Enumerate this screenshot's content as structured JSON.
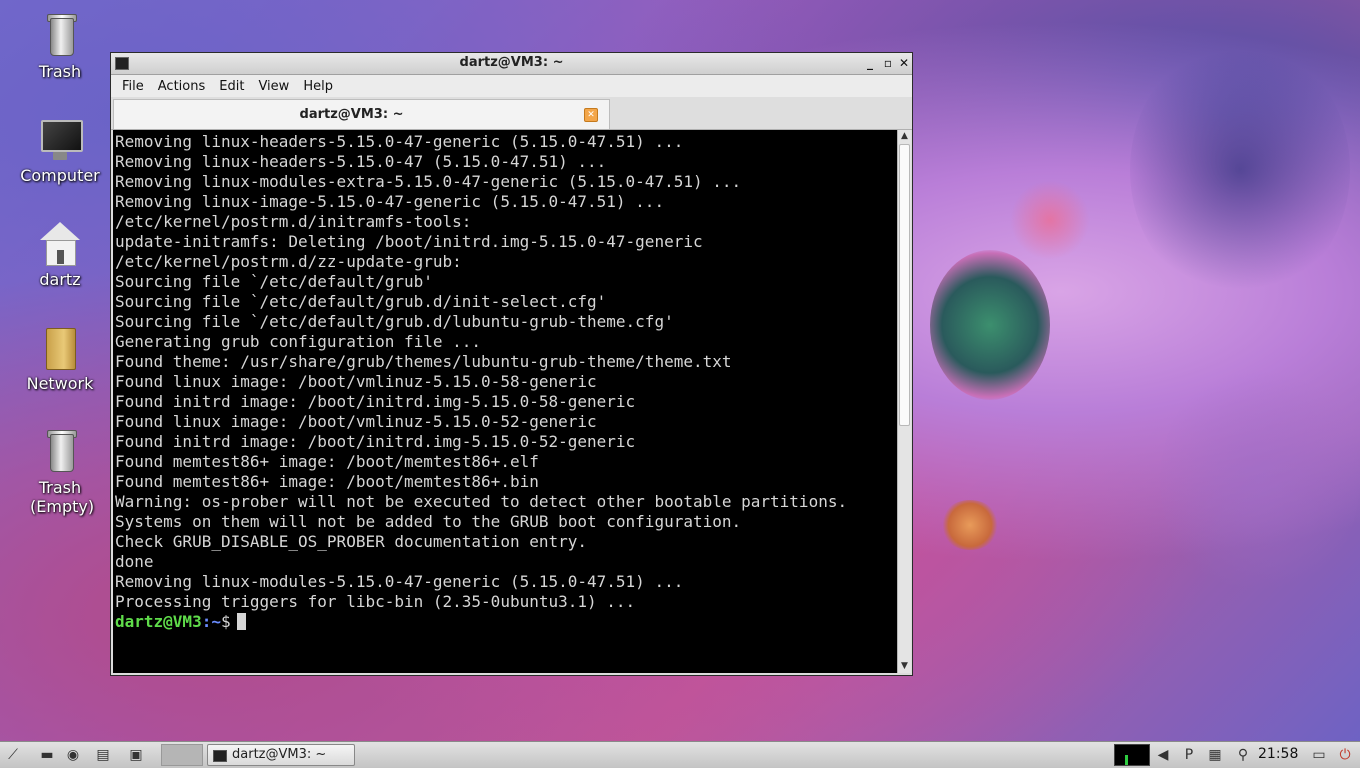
{
  "desktop": {
    "icons": [
      {
        "label": "Trash"
      },
      {
        "label": "Computer"
      },
      {
        "label": "dartz"
      },
      {
        "label": "Network"
      },
      {
        "label": "Trash (Empty)"
      }
    ]
  },
  "window": {
    "title": "dartz@VM3: ~",
    "menu": [
      "File",
      "Actions",
      "Edit",
      "View",
      "Help"
    ],
    "tab_label": "dartz@VM3: ~"
  },
  "terminal": {
    "lines": [
      "Removing linux-headers-5.15.0-47-generic (5.15.0-47.51) ...",
      "Removing linux-headers-5.15.0-47 (5.15.0-47.51) ...",
      "Removing linux-modules-extra-5.15.0-47-generic (5.15.0-47.51) ...",
      "Removing linux-image-5.15.0-47-generic (5.15.0-47.51) ...",
      "/etc/kernel/postrm.d/initramfs-tools:",
      "update-initramfs: Deleting /boot/initrd.img-5.15.0-47-generic",
      "/etc/kernel/postrm.d/zz-update-grub:",
      "Sourcing file `/etc/default/grub'",
      "Sourcing file `/etc/default/grub.d/init-select.cfg'",
      "Sourcing file `/etc/default/grub.d/lubuntu-grub-theme.cfg'",
      "Generating grub configuration file ...",
      "Found theme: /usr/share/grub/themes/lubuntu-grub-theme/theme.txt",
      "Found linux image: /boot/vmlinuz-5.15.0-58-generic",
      "Found initrd image: /boot/initrd.img-5.15.0-58-generic",
      "Found linux image: /boot/vmlinuz-5.15.0-52-generic",
      "Found initrd image: /boot/initrd.img-5.15.0-52-generic",
      "Found memtest86+ image: /boot/memtest86+.elf",
      "Found memtest86+ image: /boot/memtest86+.bin",
      "Warning: os-prober will not be executed to detect other bootable partitions.",
      "Systems on them will not be added to the GRUB boot configuration.",
      "Check GRUB_DISABLE_OS_PROBER documentation entry.",
      "done",
      "Removing linux-modules-5.15.0-47-generic (5.15.0-47.51) ...",
      "Processing triggers for libc-bin (2.35-0ubuntu3.1) ..."
    ],
    "prompt_user": "dartz@VM3",
    "prompt_path": ":~",
    "prompt_symbol": "$",
    "colors": {
      "background": "#000000",
      "text": "#d6d6d6",
      "prompt_user": "#5fdc4a",
      "prompt_path": "#6a8cff"
    }
  },
  "taskbar": {
    "task_label": "dartz@VM3: ~",
    "clock": "21:58"
  }
}
